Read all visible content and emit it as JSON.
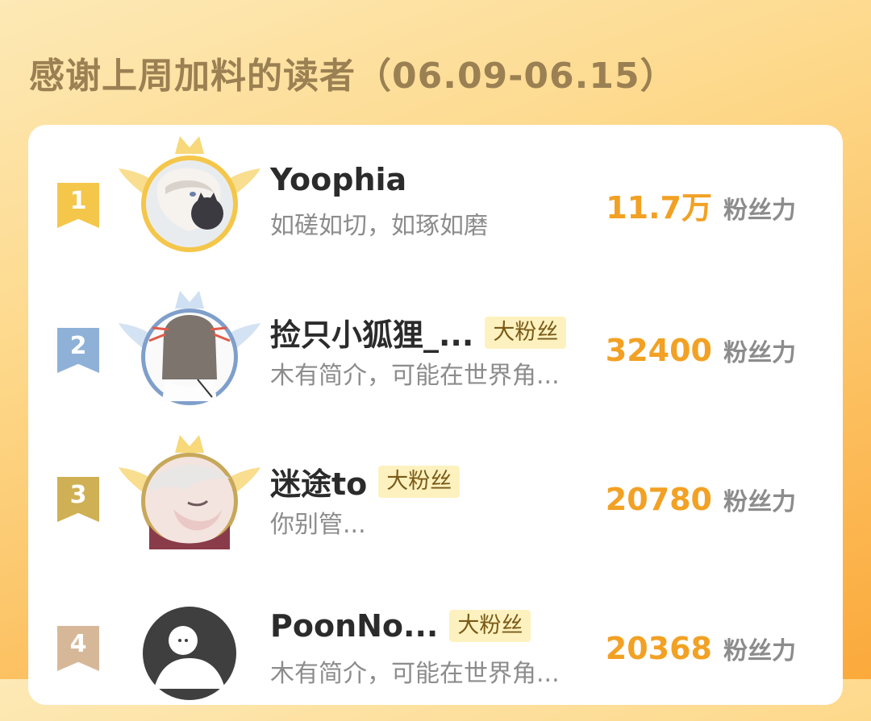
{
  "title": "感谢上周加料的读者（06.09-06.15）",
  "readers": [
    {
      "rank": "1",
      "name": "Yoophia",
      "badge": "",
      "bio": "如磋如切，如琢如磨",
      "score": "11.7万",
      "unit": "粉丝力",
      "color": "#f4c64a",
      "avatar": "avatar-illustration"
    },
    {
      "rank": "2",
      "name": "捡只小狐狸_...",
      "badge": "大粉丝",
      "bio": "木有简介，可能在世界角...",
      "score": "32400",
      "unit": "粉丝力",
      "color": "#8fb1d8",
      "avatar": "avatar-illustration"
    },
    {
      "rank": "3",
      "name": "迷途to",
      "badge": "大粉丝",
      "bio": "你别管...",
      "score": "20780",
      "unit": "粉丝力",
      "color": "#cfb054",
      "avatar": "avatar-illustration"
    },
    {
      "rank": "4",
      "name": "PoonNo...",
      "badge": "大粉丝",
      "bio": "木有简介，可能在世界角...",
      "score": "20368",
      "unit": "粉丝力",
      "color": "#d6b899",
      "avatar": "default-avatar-icon"
    }
  ]
}
